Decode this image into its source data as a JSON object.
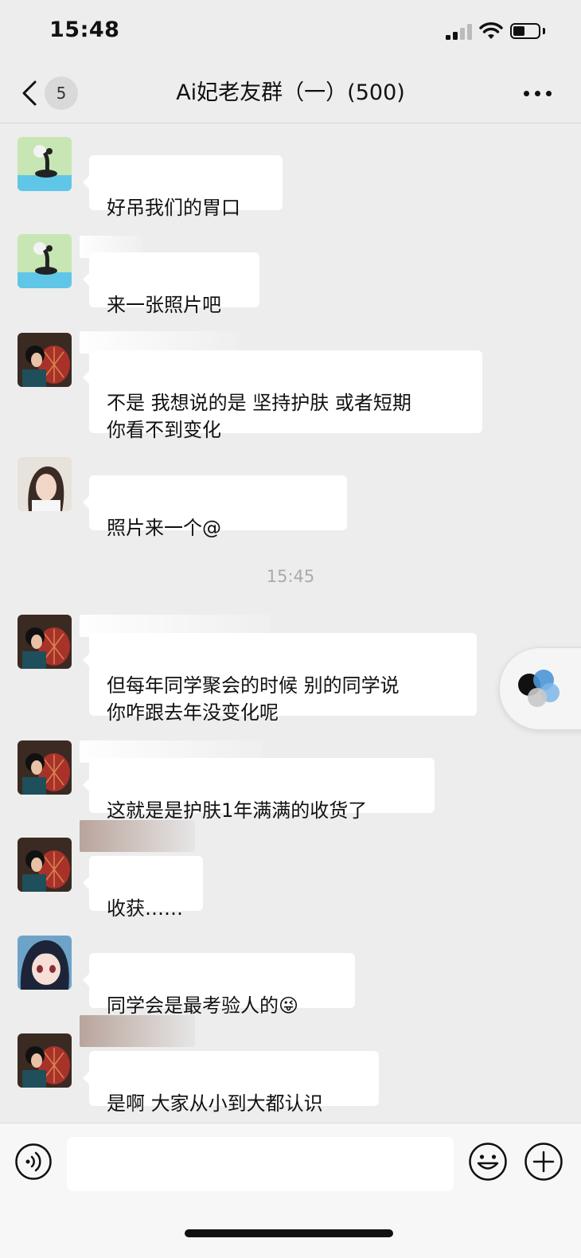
{
  "status_bar": {
    "time": "15:48"
  },
  "nav": {
    "unread_count": "5",
    "title": "Ai妃老友群（一）(500)"
  },
  "messages": [
    {
      "text": "好吊我们的胃口",
      "avatar": "yoga-avatar"
    },
    {
      "text": "来一张照片吧",
      "avatar": "yoga-avatar"
    },
    {
      "text": "不是 我想说的是 坚持护肤 或者短期\n你看不到变化",
      "avatar": "fan-lady-avatar"
    },
    {
      "text": "照片来一个@",
      "avatar": "woman-photo-avatar"
    },
    {
      "text": "但每年同学聚会的时候 别的同学说\n你咋跟去年没变化呢",
      "avatar": "fan-lady-avatar"
    },
    {
      "text": "这就是是护肤1年满满的收货了",
      "avatar": "fan-lady-avatar"
    },
    {
      "text": "收获……",
      "avatar": "fan-lady-avatar"
    },
    {
      "text": "同学会是最考验人的😜",
      "avatar": "anime-girl-avatar"
    },
    {
      "text": "是啊 大家从小到大都认识",
      "avatar": "fan-lady-avatar"
    }
  ],
  "time_divider": "15:45",
  "colors": {
    "background": "#ededed",
    "bubble": "#ffffff",
    "input_bar": "#f7f7f7"
  }
}
